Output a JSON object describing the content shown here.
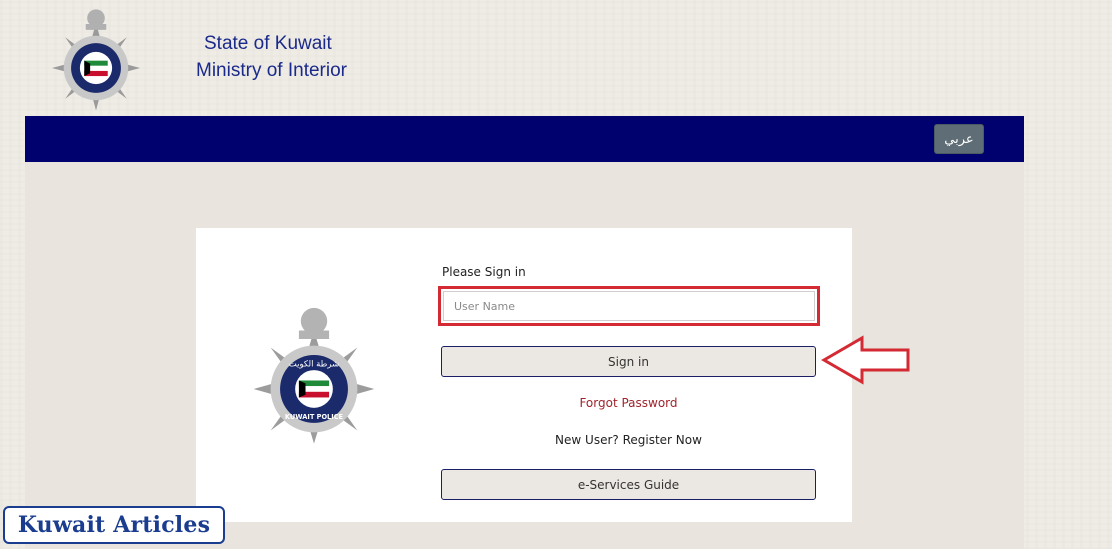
{
  "header": {
    "title_line1": "State of Kuwait",
    "title_line2": "Ministry of Interior",
    "logo_icon": "kuwait-police-emblem-icon"
  },
  "nav": {
    "language_button": "عربي"
  },
  "login": {
    "heading": "Please Sign in",
    "username_placeholder": "User Name",
    "username_value": "",
    "signin_button": "Sign in",
    "forgot_password": "Forgot Password",
    "register": "New User? Register Now",
    "guide_button": "e-Services Guide"
  },
  "emblem": {
    "arabic_text": "شرطة الكويت",
    "english_text": "KUWAIT POLICE"
  },
  "watermark": {
    "text": "Kuwait Articles"
  },
  "colors": {
    "navbar": "#00006e",
    "title": "#1a2a8a",
    "highlight": "#d42a33",
    "forgot_link": "#a0242c",
    "flag_green": "#1f8a3a",
    "flag_red": "#c8102e"
  }
}
